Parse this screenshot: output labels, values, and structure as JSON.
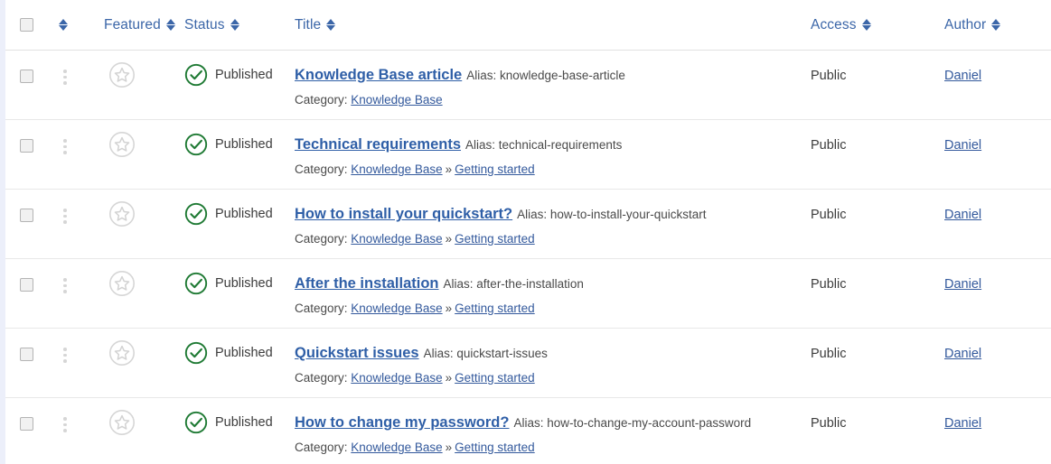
{
  "header": {
    "select_all_checkbox": "",
    "columns": [
      {
        "key": "ordering",
        "label": "",
        "sortable": true,
        "icon": "sort-updown-icon"
      },
      {
        "key": "featured",
        "label": "Featured",
        "sortable": true,
        "icon": "sort-updown-icon"
      },
      {
        "key": "status",
        "label": "Status",
        "sortable": true,
        "icon": "sort-updown-icon"
      },
      {
        "key": "title",
        "label": "Title",
        "sortable": true,
        "icon": "sort-updown-icon"
      },
      {
        "key": "access",
        "label": "Access",
        "sortable": true,
        "icon": "sort-updown-icon"
      },
      {
        "key": "author",
        "label": "Author",
        "sortable": true,
        "icon": "sort-updown-icon"
      }
    ]
  },
  "labels": {
    "alias_prefix": "Alias:",
    "category_prefix": "Category:",
    "breadcrumb_separator": "»"
  },
  "colors": {
    "link": "#2f5fa7",
    "header_link": "#3b66a8",
    "published_green": "#1f7a34",
    "row_divider": "#e8e8e8",
    "page_gutter": "#eceffa",
    "star_gray": "#d2d2d2"
  },
  "rows": [
    {
      "checkbox_checked": false,
      "drag_handle": "drag-dots-icon",
      "featured": {
        "icon": "star-outline-icon",
        "active": false
      },
      "status": {
        "icon": "check-circle-icon",
        "label": "Published"
      },
      "title": "Knowledge Base article",
      "alias": "knowledge-base-article",
      "category": [
        "Knowledge Base"
      ],
      "access": "Public",
      "author": "Daniel"
    },
    {
      "checkbox_checked": false,
      "drag_handle": "drag-dots-icon",
      "featured": {
        "icon": "star-outline-icon",
        "active": false
      },
      "status": {
        "icon": "check-circle-icon",
        "label": "Published"
      },
      "title": "Technical requirements",
      "alias": "technical-requirements",
      "category": [
        "Knowledge Base",
        "Getting started"
      ],
      "access": "Public",
      "author": "Daniel"
    },
    {
      "checkbox_checked": false,
      "drag_handle": "drag-dots-icon",
      "featured": {
        "icon": "star-outline-icon",
        "active": false
      },
      "status": {
        "icon": "check-circle-icon",
        "label": "Published"
      },
      "title": "How to install your quickstart?",
      "alias": "how-to-install-your-quickstart",
      "category": [
        "Knowledge Base",
        "Getting started"
      ],
      "access": "Public",
      "author": "Daniel"
    },
    {
      "checkbox_checked": false,
      "drag_handle": "drag-dots-icon",
      "featured": {
        "icon": "star-outline-icon",
        "active": false
      },
      "status": {
        "icon": "check-circle-icon",
        "label": "Published"
      },
      "title": "After the installation",
      "alias": "after-the-installation",
      "category": [
        "Knowledge Base",
        "Getting started"
      ],
      "access": "Public",
      "author": "Daniel"
    },
    {
      "checkbox_checked": false,
      "drag_handle": "drag-dots-icon",
      "featured": {
        "icon": "star-outline-icon",
        "active": false
      },
      "status": {
        "icon": "check-circle-icon",
        "label": "Published"
      },
      "title": "Quickstart issues",
      "alias": "quickstart-issues",
      "category": [
        "Knowledge Base",
        "Getting started"
      ],
      "access": "Public",
      "author": "Daniel"
    },
    {
      "checkbox_checked": false,
      "drag_handle": "drag-dots-icon",
      "featured": {
        "icon": "star-outline-icon",
        "active": false
      },
      "status": {
        "icon": "check-circle-icon",
        "label": "Published"
      },
      "title": "How to change my password?",
      "alias": "how-to-change-my-account-password",
      "category": [
        "Knowledge Base",
        "Getting started"
      ],
      "access": "Public",
      "author": "Daniel"
    }
  ]
}
